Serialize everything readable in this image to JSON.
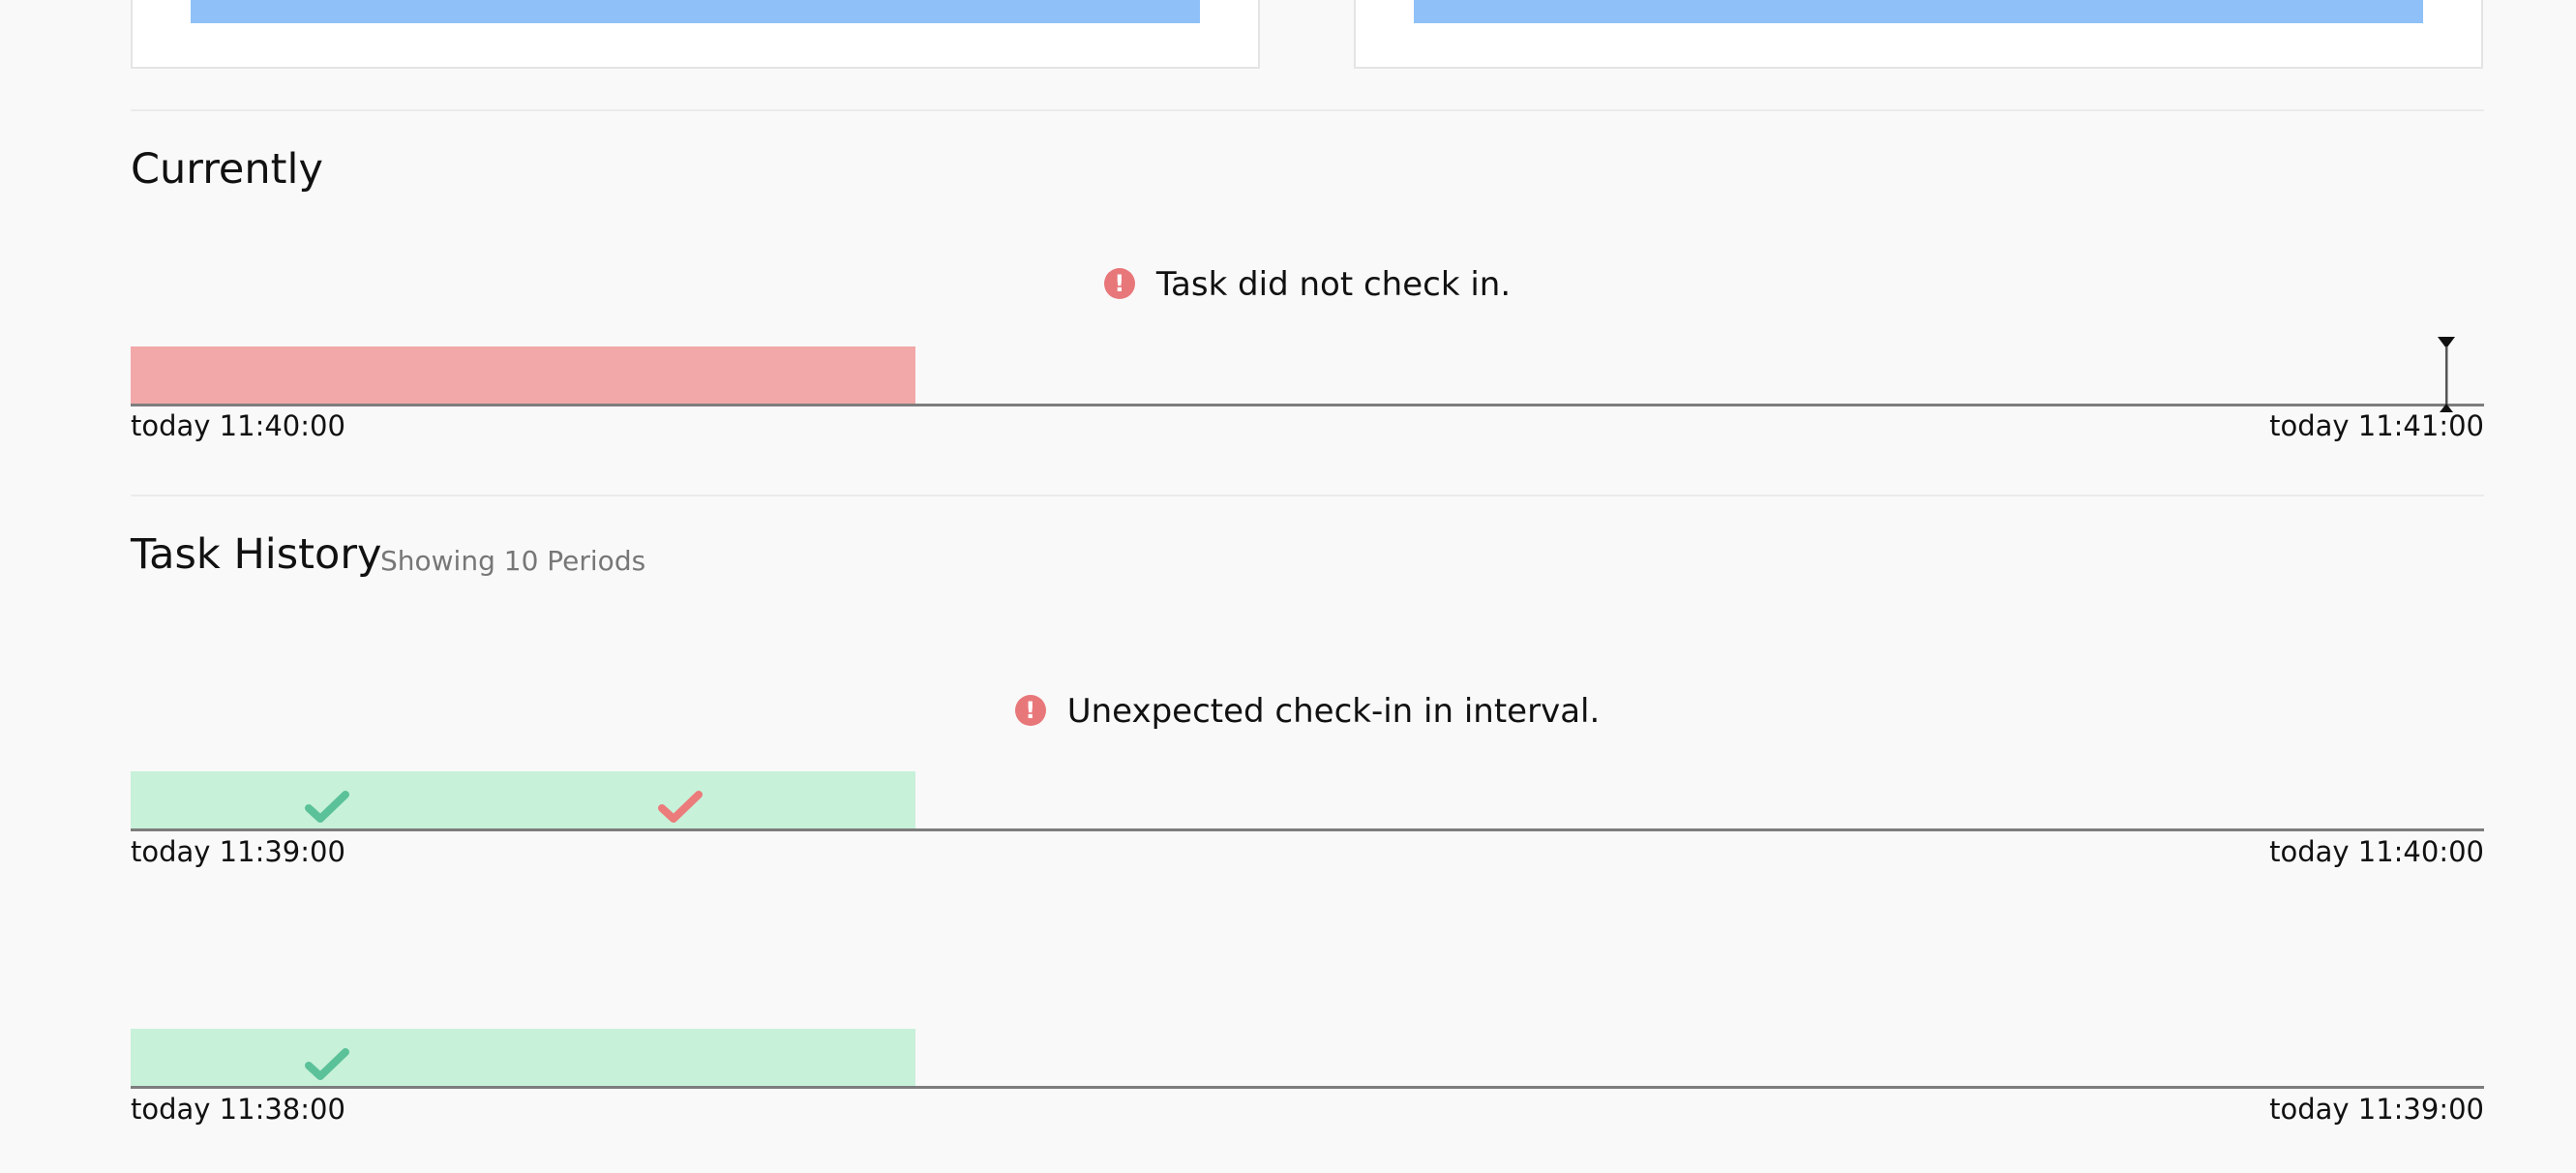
{
  "colors": {
    "card_bar": "#8fc1f8",
    "missed_interval": "#f2a8a8",
    "ok_interval": "#c7f1d9",
    "check_ok": "#5bc199",
    "check_bad": "#ec7b7b",
    "alert": "#e8777a"
  },
  "currently": {
    "title": "Currently",
    "status_icon": "alert-circle-icon",
    "status_text": "Task did not check in.",
    "start_label": "today 11:40:00",
    "end_label": "today 11:41:00"
  },
  "history": {
    "title": "Task History",
    "subtitle": "Showing 10 Periods",
    "periods": [
      {
        "status_icon": "alert-circle-icon",
        "status_text": "Unexpected check-in in interval.",
        "start_label": "today 11:39:00",
        "end_label": "today 11:40:00",
        "checkins": [
          {
            "icon": "check-icon",
            "status": "ok"
          },
          {
            "icon": "check-icon",
            "status": "unexpected"
          }
        ]
      },
      {
        "status_text": "",
        "start_label": "today 11:38:00",
        "end_label": "today 11:39:00",
        "checkins": [
          {
            "icon": "check-icon",
            "status": "ok"
          }
        ]
      }
    ]
  }
}
